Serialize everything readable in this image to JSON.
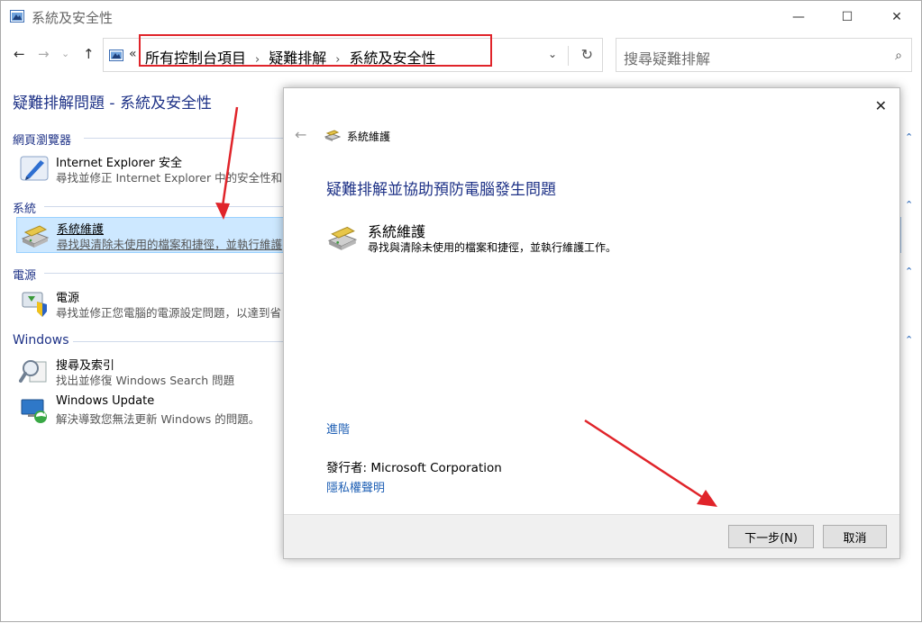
{
  "window": {
    "title": "系統及安全性",
    "controls": {
      "minimize": "—",
      "maximize": "☐",
      "close": "✕"
    }
  },
  "nav": {
    "back": "←",
    "forward": "→",
    "dropdown": "⌄",
    "up": "↑"
  },
  "address": {
    "chevron": "«",
    "crumbs": [
      "所有控制台項目",
      "疑難排解",
      "系統及安全性"
    ],
    "separator": "›",
    "dropdown": "⌄",
    "refresh": "↻"
  },
  "search": {
    "placeholder": "搜尋疑難排解",
    "icon": "⌕"
  },
  "left": {
    "page_title": "疑難排解問題 - 系統及安全性",
    "groups": [
      {
        "header": "網頁瀏覽器",
        "items": [
          {
            "title": "Internet Explorer 安全",
            "desc": "尋找並修正 Internet Explorer 中的安全性和隱"
          }
        ]
      },
      {
        "header": "系統",
        "items": [
          {
            "title": "系統維護",
            "desc": "尋找與清除未使用的檔案和捷徑，並執行維護"
          }
        ]
      },
      {
        "header": "電源",
        "items": [
          {
            "title": "電源",
            "desc": "尋找並修正您電腦的電源設定問題，以達到省"
          }
        ]
      },
      {
        "header": "Windows",
        "items": [
          {
            "title": "搜尋及索引",
            "desc": "找出並修復 Windows Search 問題"
          },
          {
            "title": "Windows Update",
            "desc": "解決導致您無法更新 Windows 的問題。"
          }
        ]
      }
    ],
    "collapse_glyph": "⌃"
  },
  "dialog": {
    "close": "✕",
    "back": "←",
    "app_title": "系統維護",
    "heading": "疑難排解並協助預防電腦發生問題",
    "item_title": "系統維護",
    "item_desc": "尋找與清除未使用的檔案和捷徑，並執行維護工作。",
    "advanced": "進階",
    "publisher": "發行者:  Microsoft Corporation",
    "privacy": "隱私權聲明",
    "next_button": "下一步(N)",
    "cancel_button": "取消"
  },
  "colors": {
    "accent": "#1e3287",
    "link": "#1e5fb4",
    "highlight": "#e0242a",
    "selection": "#cde8ff"
  }
}
